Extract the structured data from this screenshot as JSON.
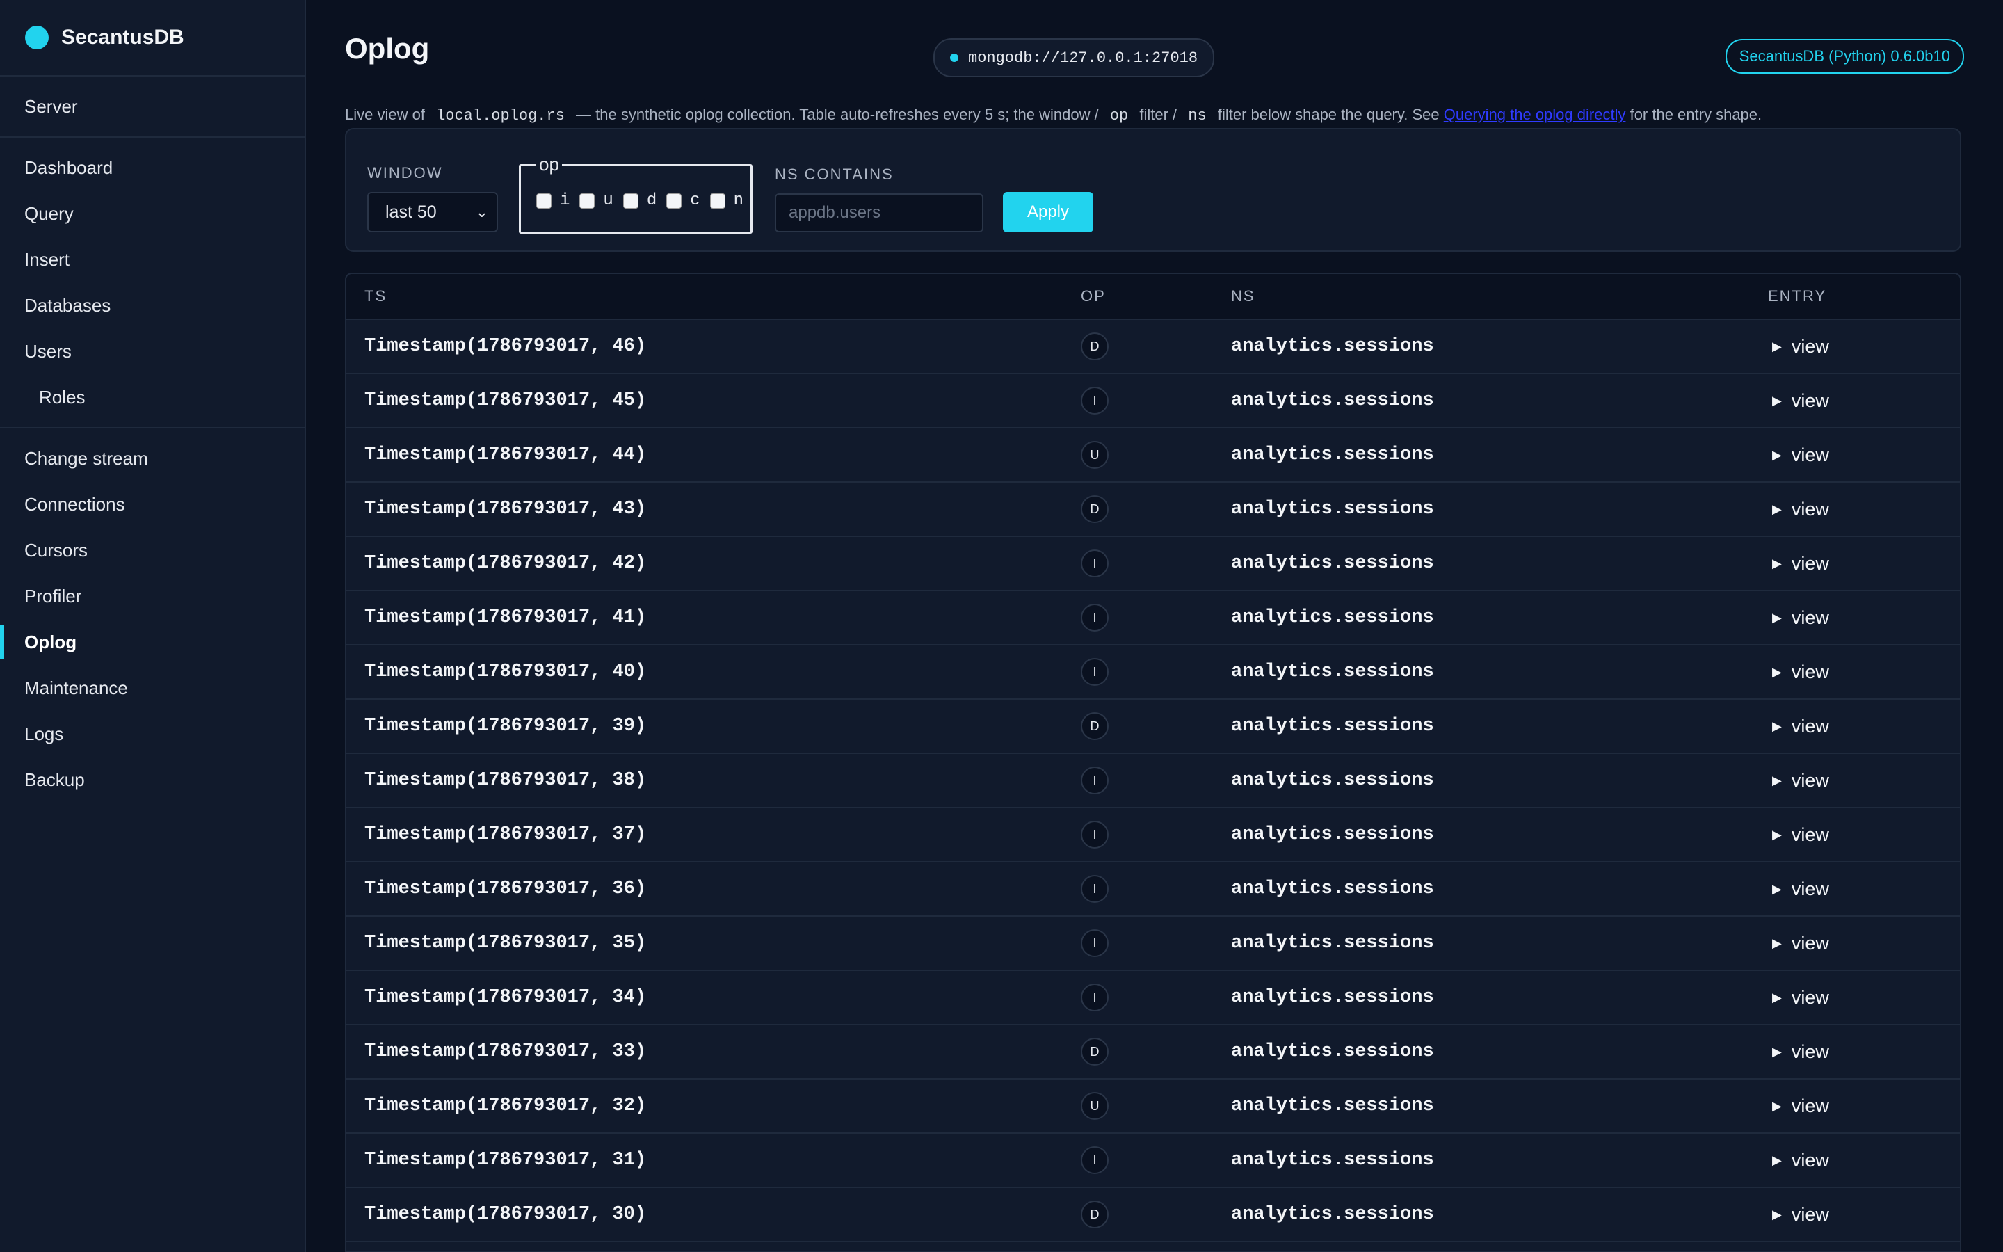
{
  "brand": {
    "name": "SecantusDB",
    "accent": "#22d3ee"
  },
  "sidebar": {
    "server": "Server",
    "group2": [
      "Dashboard",
      "Query",
      "Insert",
      "Databases",
      "Users",
      "Roles"
    ],
    "group3": [
      "Change stream",
      "Connections",
      "Cursors",
      "Profiler",
      "Oplog",
      "Maintenance",
      "Logs",
      "Backup"
    ],
    "active": "Oplog"
  },
  "header": {
    "title": "Oplog",
    "connection": "mongodb://127.0.0.1:27018",
    "version": "SecantusDB (Python) 0.6.0b10"
  },
  "description": {
    "p1": "Live view of",
    "code1": "local.oplog.rs",
    "p2": "— the synthetic oplog collection. Table auto-refreshes every 5 s; the window /",
    "code2": "op",
    "p3": "filter /",
    "code3": "ns",
    "p4": "filter below shape the query. See",
    "link": "Querying the oplog directly",
    "p5": "for the entry shape."
  },
  "filters": {
    "window_label": "WINDOW",
    "window_value": "last 50",
    "op_legend": "op",
    "op_options": [
      "i",
      "u",
      "d",
      "c",
      "n"
    ],
    "ns_label": "NS CONTAINS",
    "ns_placeholder": "appdb.users",
    "apply_label": "Apply"
  },
  "table": {
    "columns": [
      "TS",
      "OP",
      "NS",
      "ENTRY"
    ],
    "rows": [
      {
        "ts": "Timestamp(1786793017, 46)",
        "op": "D",
        "ns": "analytics.sessions",
        "entry": "view"
      },
      {
        "ts": "Timestamp(1786793017, 45)",
        "op": "I",
        "ns": "analytics.sessions",
        "entry": "view"
      },
      {
        "ts": "Timestamp(1786793017, 44)",
        "op": "U",
        "ns": "analytics.sessions",
        "entry": "view"
      },
      {
        "ts": "Timestamp(1786793017, 43)",
        "op": "D",
        "ns": "analytics.sessions",
        "entry": "view"
      },
      {
        "ts": "Timestamp(1786793017, 42)",
        "op": "I",
        "ns": "analytics.sessions",
        "entry": "view"
      },
      {
        "ts": "Timestamp(1786793017, 41)",
        "op": "I",
        "ns": "analytics.sessions",
        "entry": "view"
      },
      {
        "ts": "Timestamp(1786793017, 40)",
        "op": "I",
        "ns": "analytics.sessions",
        "entry": "view"
      },
      {
        "ts": "Timestamp(1786793017, 39)",
        "op": "D",
        "ns": "analytics.sessions",
        "entry": "view"
      },
      {
        "ts": "Timestamp(1786793017, 38)",
        "op": "I",
        "ns": "analytics.sessions",
        "entry": "view"
      },
      {
        "ts": "Timestamp(1786793017, 37)",
        "op": "I",
        "ns": "analytics.sessions",
        "entry": "view"
      },
      {
        "ts": "Timestamp(1786793017, 36)",
        "op": "I",
        "ns": "analytics.sessions",
        "entry": "view"
      },
      {
        "ts": "Timestamp(1786793017, 35)",
        "op": "I",
        "ns": "analytics.sessions",
        "entry": "view"
      },
      {
        "ts": "Timestamp(1786793017, 34)",
        "op": "I",
        "ns": "analytics.sessions",
        "entry": "view"
      },
      {
        "ts": "Timestamp(1786793017, 33)",
        "op": "D",
        "ns": "analytics.sessions",
        "entry": "view"
      },
      {
        "ts": "Timestamp(1786793017, 32)",
        "op": "U",
        "ns": "analytics.sessions",
        "entry": "view"
      },
      {
        "ts": "Timestamp(1786793017, 31)",
        "op": "I",
        "ns": "analytics.sessions",
        "entry": "view"
      },
      {
        "ts": "Timestamp(1786793017, 30)",
        "op": "D",
        "ns": "analytics.sessions",
        "entry": "view"
      }
    ]
  }
}
